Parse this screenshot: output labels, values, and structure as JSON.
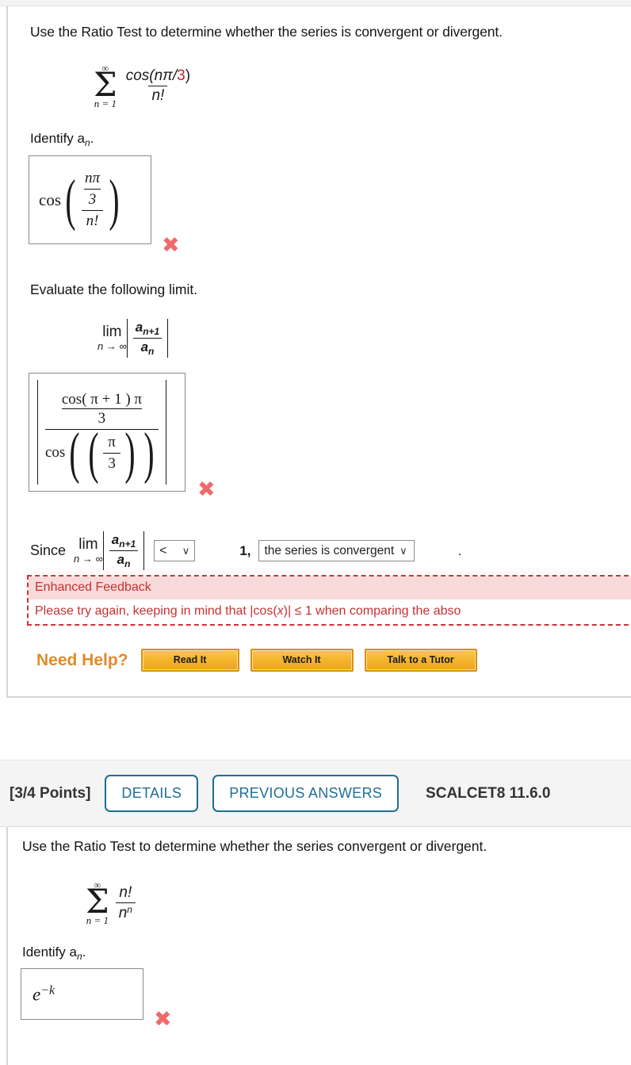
{
  "question1": {
    "prompt": "Use the Ratio Test to determine whether the series is convergent or divergent.",
    "series": {
      "sigma_top": "∞",
      "sigma_bottom": "n = 1",
      "numerator": "cos(nπ/",
      "numerator_red": "3",
      "numerator_close": ")",
      "denominator": "n!"
    },
    "identify_label": "Identify a",
    "identify_sub": "n",
    "identify_period": ".",
    "answer1": {
      "fn": "cos",
      "inner_num_a": "n",
      "inner_num_b": "π",
      "inner_mid": "3",
      "inner_den": "n!",
      "status": "incorrect"
    },
    "evaluate_label": "Evaluate the following limit.",
    "limit": {
      "lim_word": "lim",
      "lim_sub": "n → ∞",
      "num_a": "a",
      "num_sub": "n+1",
      "den_a": "a",
      "den_sub": "n"
    },
    "answer2": {
      "top_num_cos": "cos",
      "top_num_arg": "( π + 1 ) π",
      "top_den": "3",
      "bottom_cos": "cos",
      "bottom_num": "π",
      "bottom_den": "3",
      "status": "incorrect"
    },
    "since": {
      "word": "Since",
      "lim_word": "lim",
      "lim_sub": "n → ∞",
      "num_a": "a",
      "num_sub": "n+1",
      "den_a": "a",
      "den_sub": "n",
      "compare_value": "<",
      "one_label": "1,",
      "conclusion_value": "the series is convergent",
      "trailing_period": "."
    },
    "feedback": {
      "title": "Enhanced Feedback",
      "body_part1": "Please try again, keeping in mind that |cos(",
      "body_var": "x",
      "body_part2": ")| ≤ 1 when comparing the abso"
    },
    "need_help": {
      "label": "Need Help?",
      "buttons": [
        "Read It",
        "Watch It",
        "Talk to a Tutor"
      ]
    }
  },
  "question2": {
    "points": "[3/4 Points]",
    "details_button": "DETAILS",
    "previous_answers_button": "PREVIOUS ANSWERS",
    "reference": "SCALCET8 11.6.0",
    "prompt": "Use the Ratio Test to determine whether the series convergent or divergent.",
    "series": {
      "sigma_top": "∞",
      "sigma_bottom": "n = 1",
      "numerator": "n!",
      "denominator_base": "n",
      "denominator_exp": "n"
    },
    "identify_label": "Identify a",
    "identify_sub": "n",
    "identify_period": ".",
    "answer3": {
      "base": "e",
      "exponent": "−k",
      "status": "incorrect"
    }
  },
  "icons": {
    "incorrect_mark": "✖",
    "caret_down": "∨"
  },
  "colors": {
    "accent_red": "#c0242c",
    "incorrect": "#f0696b",
    "feedback_border": "#cf3333",
    "feedback_bg": "#f9dada",
    "pill_blue": "#1d6e94",
    "help_orange": "#e08b28"
  }
}
